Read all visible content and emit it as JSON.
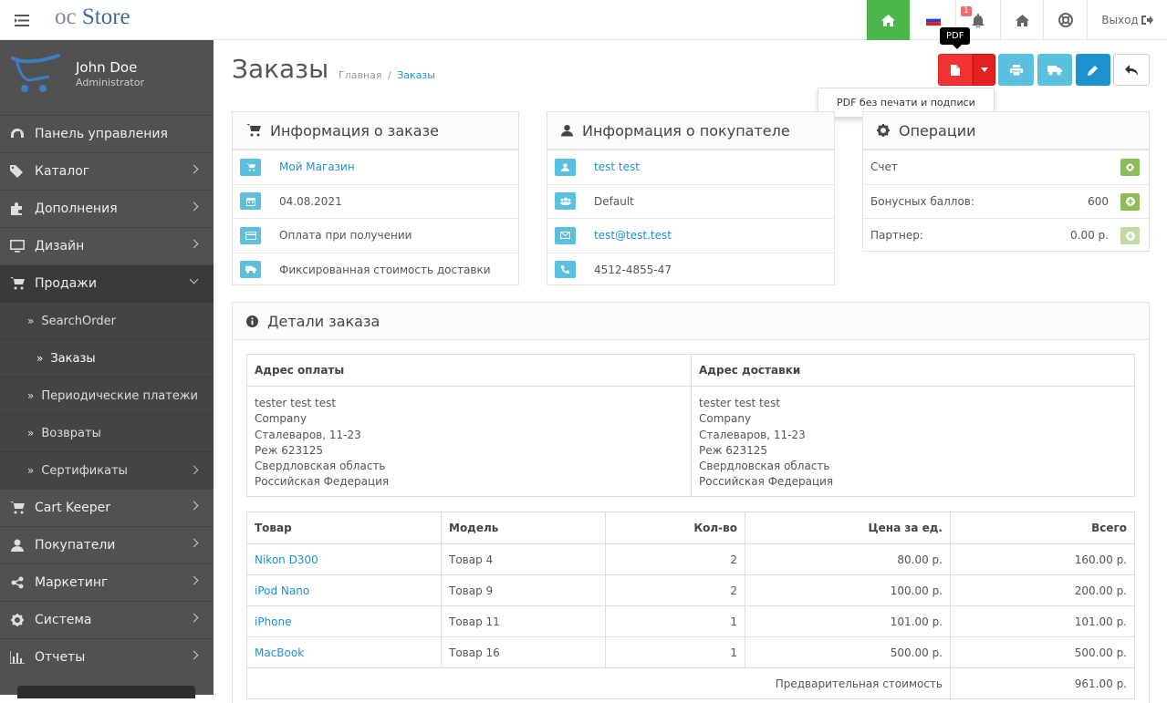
{
  "header": {
    "logo_prefix": "oc",
    "logo_main": "Store",
    "notification_count": "1",
    "logout_label": "Выход"
  },
  "profile": {
    "name": "John Doe",
    "role": "Administrator"
  },
  "nav": [
    {
      "label": "Панель управления"
    },
    {
      "label": "Каталог"
    },
    {
      "label": "Дополнения"
    },
    {
      "label": "Дизайн"
    },
    {
      "label": "Продажи"
    },
    {
      "label": "Cart Keeper"
    },
    {
      "label": "Покупатели"
    },
    {
      "label": "Маркетинг"
    },
    {
      "label": "Система"
    },
    {
      "label": "Отчеты"
    }
  ],
  "subnav": [
    {
      "label": "SearchOrder"
    },
    {
      "label": "Заказы"
    },
    {
      "label": "Периодические платежи"
    },
    {
      "label": "Возвраты"
    },
    {
      "label": "Сертификаты"
    }
  ],
  "page": {
    "title": "Заказы",
    "breadcrumb_home": "Главная",
    "breadcrumb_sep": "/",
    "breadcrumb_current": "Заказы",
    "tooltip": "PDF",
    "dropdown_item": "PDF без печати и подписи"
  },
  "order_info": {
    "title": "Информация о заказе",
    "store": "Мой Магазин",
    "date": "04.08.2021",
    "payment": "Оплата при получении",
    "shipping": "Фиксированная стоимость доставки"
  },
  "customer_info": {
    "title": "Информация о покупателе",
    "name": "test test",
    "group": "Default",
    "email": "test@test.test",
    "phone": "4512-4855-47"
  },
  "operations": {
    "title": "Операции",
    "invoice_label": "Счет",
    "bonus_label": "Бонусных баллов:",
    "bonus_value": "600",
    "partner_label": "Партнер:",
    "partner_value": "0.00 р."
  },
  "details": {
    "title": "Детали заказа",
    "billing_header": "Адрес оплаты",
    "shipping_header": "Адрес доставки",
    "billing_lines": [
      "tester test test",
      "Company",
      "Сталеваров, 11-23",
      "Реж 623125",
      "Свердловская область",
      "Российская Федерация"
    ],
    "shipping_lines": [
      "tester test test",
      "Company",
      "Сталеваров, 11-23",
      "Реж 623125",
      "Свердловская область",
      "Российская Федерация"
    ],
    "columns": {
      "product": "Товар",
      "model": "Модель",
      "qty": "Кол-во",
      "price": "Цена за ед.",
      "total": "Всего"
    },
    "products": [
      {
        "name": "Nikon D300",
        "model": "Товар 4",
        "qty": "2",
        "price": "80.00 р.",
        "total": "160.00 р."
      },
      {
        "name": "iPod Nano",
        "model": "Товар 9",
        "qty": "2",
        "price": "100.00 р.",
        "total": "200.00 р."
      },
      {
        "name": "iPhone",
        "model": "Товар 11",
        "qty": "1",
        "price": "101.00 р.",
        "total": "101.00 р."
      },
      {
        "name": "MacBook",
        "model": "Товар 16",
        "qty": "1",
        "price": "500.00 р.",
        "total": "500.00 р."
      }
    ],
    "subtotal_label": "Предварительная стоимость",
    "subtotal_value": "961.00 р."
  },
  "colors": {
    "accent": "#1e91cf",
    "info": "#5bc0de",
    "danger": "#f33333",
    "success": "#4cb64c",
    "sidebar": "#515151"
  }
}
